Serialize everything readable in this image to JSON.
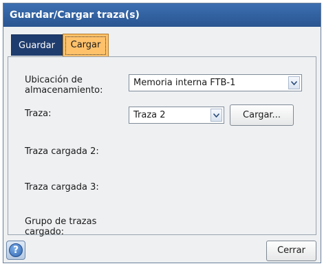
{
  "window": {
    "title": "Guardar/Cargar traza(s)"
  },
  "tabs": [
    {
      "label": "Guardar",
      "active": false
    },
    {
      "label": "Cargar",
      "active": true
    }
  ],
  "form": {
    "storage_label": "Ubicación de almacenamiento:",
    "storage_value": "Memoria interna FTB-1",
    "trace_label": "Traza:",
    "trace_value": "Traza 2",
    "load_button": "Cargar...",
    "loaded_trace_2_label": "Traza cargada 2:",
    "loaded_trace_3_label": "Traza cargada 3:",
    "loaded_group_label": "Grupo de trazas cargado:"
  },
  "footer": {
    "help_icon": "question-mark-icon",
    "close_button": "Cerrar"
  },
  "colors": {
    "titlebar": "#2f5f9f",
    "active_tab": "#ffc26b",
    "inactive_tab": "#1f3c6e",
    "panel": "#eef0f2"
  }
}
